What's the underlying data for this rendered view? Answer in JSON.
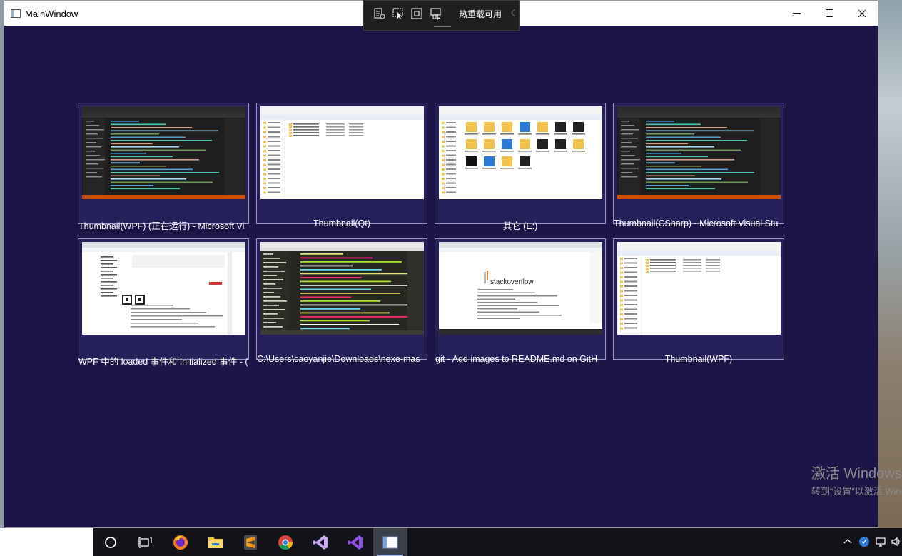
{
  "window": {
    "title": "MainWindow",
    "background": "#1c1647",
    "controls": {
      "minimize": "minimize-icon",
      "maximize": "maximize-icon",
      "close": "close-icon"
    }
  },
  "hot_reload_toolbar": {
    "label": "热重载可用",
    "icons": [
      "live-visual-tree-icon",
      "select-element-icon",
      "display-layout-adorners-icon",
      "track-focused-element-icon"
    ]
  },
  "thumbnails": [
    {
      "caption": "Thumbnail(WPF) (正在运行) - Microsoft Vi",
      "kind": "vs-dark"
    },
    {
      "caption": "Thumbnail(Qt)",
      "kind": "explorer-list"
    },
    {
      "caption": "其它 (E:)",
      "kind": "explorer-icons"
    },
    {
      "caption": "Thumbnail(CSharp) - Microsoft Visual Stu",
      "kind": "vs-dark"
    },
    {
      "caption": "WPF 中的 loaded 事件和 Initialized 事件 - (",
      "kind": "browser-doc"
    },
    {
      "caption": "C:\\Users\\caoyanjie\\Downloads\\nexe-mas",
      "kind": "sublime"
    },
    {
      "caption": "git - Add images to README.md on GitH",
      "kind": "stackoverflow",
      "logo_text": "stackoverflow"
    },
    {
      "caption": "Thumbnail(WPF)",
      "kind": "explorer-list"
    }
  ],
  "activation_notice": {
    "line1": "激活 Windows",
    "line2": "转到“设置”以激活 Windows。"
  },
  "taskbar": {
    "apps": [
      "cortana-icon",
      "task-view-icon",
      "firefox-icon",
      "file-explorer-icon",
      "sublime-text-icon",
      "chrome-icon",
      "visual-studio-icon",
      "visual-studio-preview-icon",
      "wpf-app-icon"
    ],
    "active_app": "wpf-app-icon",
    "tray": [
      "show-hidden-icons-icon",
      "network-shield-icon",
      "network-icon",
      "volume-icon"
    ]
  }
}
